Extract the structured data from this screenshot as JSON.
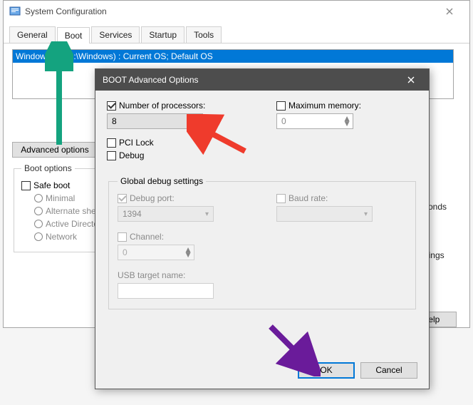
{
  "window": {
    "title": "System Configuration",
    "tabs": [
      "General",
      "Boot",
      "Services",
      "Startup",
      "Tools"
    ],
    "active_tab": 1,
    "bootlist_item": "Windows 10 (C:\\Windows) : Current OS; Default OS",
    "adv_button": "Advanced options",
    "boot_options_legend": "Boot options",
    "safe_boot": "Safe boot",
    "radios": [
      "Minimal",
      "Alternate shell",
      "Active Directory repair",
      "Network"
    ],
    "right_labels": [
      "seconds",
      "settings"
    ],
    "help": "Help"
  },
  "modal": {
    "title": "BOOT Advanced Options",
    "num_proc_label": "Number of processors:",
    "num_proc_value": "8",
    "max_mem_label": "Maximum memory:",
    "max_mem_value": "0",
    "pci_lock": "PCI Lock",
    "debug": "Debug",
    "gds_legend": "Global debug settings",
    "debug_port_label": "Debug port:",
    "debug_port_value": "1394",
    "baud_label": "Baud rate:",
    "baud_value": "",
    "channel_label": "Channel:",
    "channel_value": "0",
    "usb_label": "USB target name:",
    "ok": "OK",
    "cancel": "Cancel"
  }
}
